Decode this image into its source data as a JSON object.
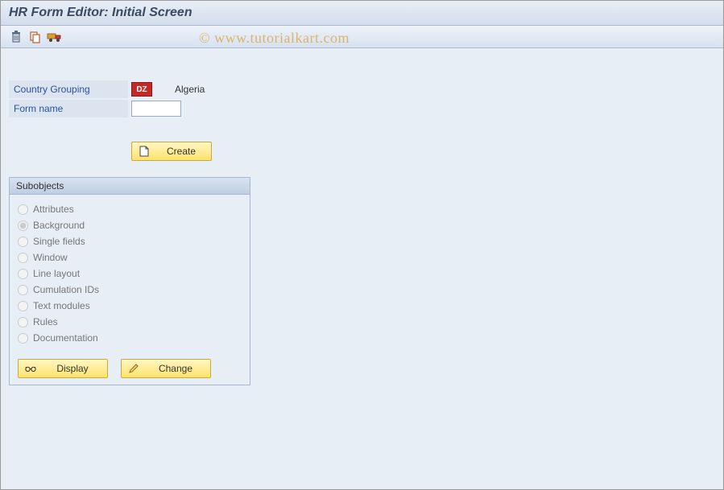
{
  "title": "HR Form Editor: Initial Screen",
  "watermark": "© www.tutorialkart.com",
  "toolbar_icons": {
    "delete": "delete-icon",
    "copy": "copy-icon",
    "transport": "transport-icon"
  },
  "fields": {
    "country_grouping": {
      "label": "Country Grouping",
      "value": "DZ",
      "description": "Algeria"
    },
    "form_name": {
      "label": "Form name",
      "value": ""
    }
  },
  "buttons": {
    "create": "Create",
    "display": "Display",
    "change": "Change"
  },
  "subobjects": {
    "title": "Subobjects",
    "options": [
      {
        "key": "attributes",
        "label": "Attributes",
        "checked": false
      },
      {
        "key": "background",
        "label": "Background",
        "checked": true
      },
      {
        "key": "single_fields",
        "label": "Single fields",
        "checked": false
      },
      {
        "key": "window",
        "label": "Window",
        "checked": false
      },
      {
        "key": "line_layout",
        "label": "Line layout",
        "checked": false
      },
      {
        "key": "cumulation_ids",
        "label": "Cumulation IDs",
        "checked": false
      },
      {
        "key": "text_modules",
        "label": "Text modules",
        "checked": false
      },
      {
        "key": "rules",
        "label": "Rules",
        "checked": false
      },
      {
        "key": "documentation",
        "label": "Documentation",
        "checked": false
      }
    ]
  }
}
